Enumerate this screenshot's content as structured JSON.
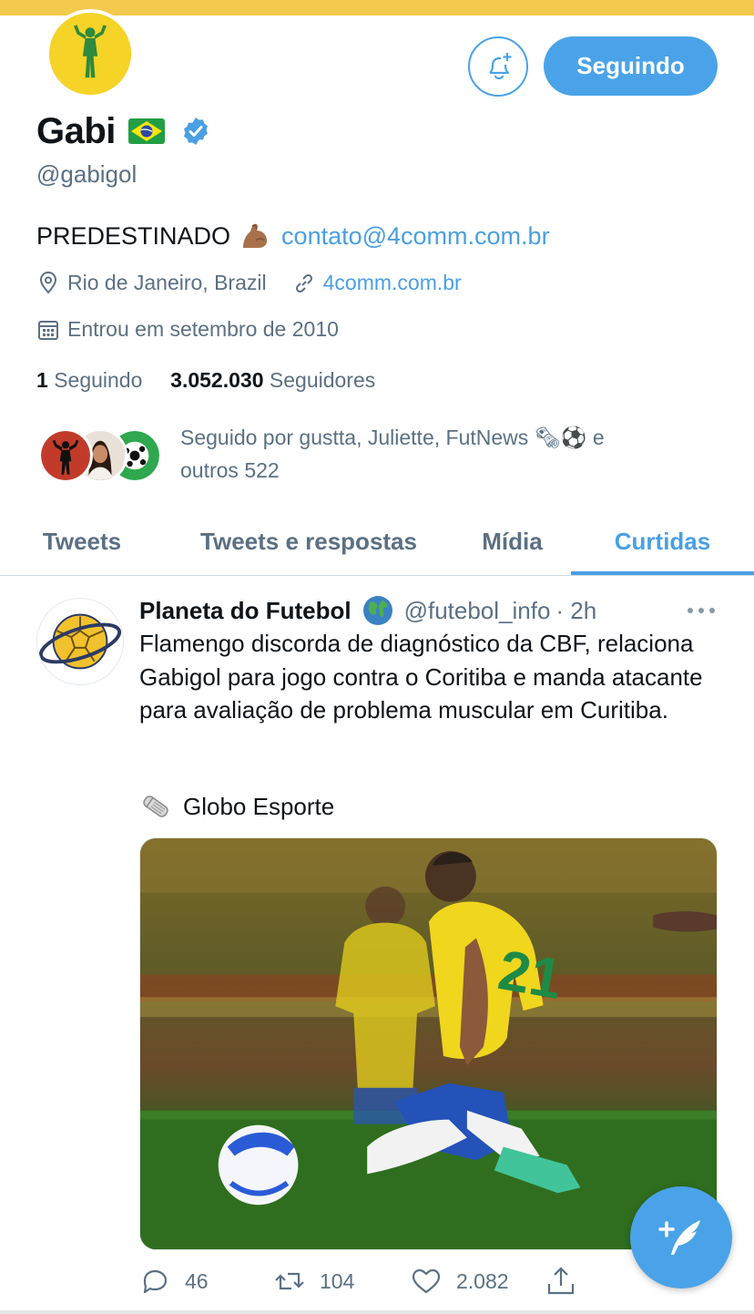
{
  "profile": {
    "display_name": "Gabi",
    "handle": "@gabigol",
    "bio_text": "PREDESTINADO",
    "bio_email": "contato@4comm.com.br",
    "location": "Rio de Janeiro, Brazil",
    "website": "4comm.com.br",
    "joined": "Entrou em setembro de 2010",
    "following_count": "1",
    "following_label": "Seguindo",
    "followers_count": "3.052.030",
    "followers_label": "Seguidores",
    "followed_by_line1": "Seguido por gustta, Juliette, FutNews 🗞⚽ e",
    "followed_by_line2": "outros 522"
  },
  "header": {
    "follow_button_label": "Seguindo",
    "notify_icon": "bell-plus-icon"
  },
  "tabs": [
    {
      "label": "Tweets",
      "active": false
    },
    {
      "label": "Tweets e respostas",
      "active": false
    },
    {
      "label": "Mídia",
      "active": false
    },
    {
      "label": "Curtidas",
      "active": true
    }
  ],
  "tweet": {
    "author_name": "Planeta do Futebol",
    "author_handle": "@futebol_info",
    "time": "· 2h",
    "text": "Flamengo discorda de diagnóstico da CBF, relaciona Gabigol para jogo contra o Coritiba e manda atacante para avaliação de problema muscular em Curitiba.",
    "source": "Globo Esporte",
    "replies": "46",
    "retweets": "104",
    "likes": "2.082"
  },
  "colors": {
    "accent": "#4aa3e8",
    "link": "#4a9fe3",
    "secondary_text": "#5b7083",
    "banner": "#f2c94c"
  }
}
